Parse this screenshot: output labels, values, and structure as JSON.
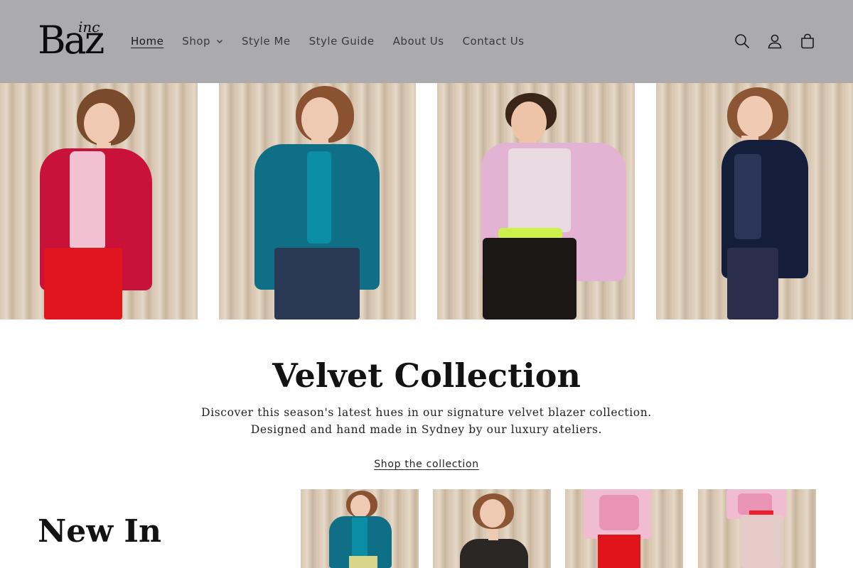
{
  "header": {
    "logo_text": "Baz",
    "logo_sub": "inc",
    "nav": [
      {
        "label": "Home",
        "active": true
      },
      {
        "label": "Shop",
        "dropdown": true
      },
      {
        "label": "Style Me"
      },
      {
        "label": "Style Guide"
      },
      {
        "label": "About Us"
      },
      {
        "label": "Contact Us"
      }
    ],
    "icons": [
      "search-icon",
      "account-icon",
      "cart-icon"
    ]
  },
  "hero": {
    "images": [
      {
        "name": "red-velvet-blazer-look",
        "blazer_color": "#c8123a"
      },
      {
        "name": "teal-velvet-blazer-look",
        "blazer_color": "#0f6f86"
      },
      {
        "name": "pink-velvet-blazer-look",
        "blazer_color": "#e3b3d3"
      },
      {
        "name": "navy-velvet-blazer-look",
        "blazer_color": "#141e3a"
      }
    ]
  },
  "collection": {
    "title": "Velvet Collection",
    "desc_line1": "Discover this season's latest hues in our signature velvet blazer collection.",
    "desc_line2": "Designed and hand made in Sydney by our luxury ateliers.",
    "link": "Shop the collection"
  },
  "new_in": {
    "title": "New In",
    "products": [
      {
        "name": "teal-velvet-blazer-product"
      },
      {
        "name": "black-satin-shirt-product"
      },
      {
        "name": "pink-floral-shirt-red-pants-product"
      },
      {
        "name": "pink-floral-shirt-satin-skirt-product"
      }
    ]
  },
  "colors": {
    "header_bg": "#ababae",
    "curtain": "#d7c6b1",
    "text": "#121212"
  }
}
